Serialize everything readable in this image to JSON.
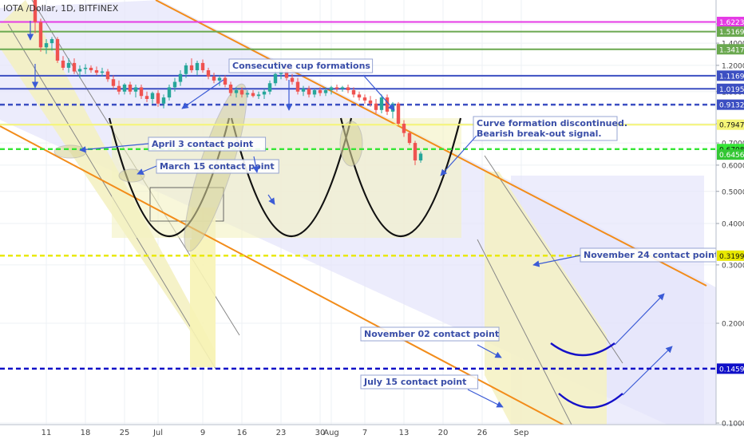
{
  "header": {
    "symbol_line": "IOTA /Dollar, 1D, BITFINEX"
  },
  "chart_data": {
    "type": "candlestick",
    "price_range": [
      0.1,
      1.65
    ],
    "price_scale": "log",
    "y_ticks": [
      {
        "value": 1.6,
        "label": "1.6000"
      },
      {
        "value": 1.4,
        "label": "1.4000"
      },
      {
        "value": 1.2,
        "label": "1.2000"
      },
      {
        "value": 1.0,
        "label": "1.0000"
      },
      {
        "value": 0.8,
        "label": "0.8000"
      },
      {
        "value": 0.7,
        "label": "0.7000"
      },
      {
        "value": 0.6,
        "label": "0.6000"
      },
      {
        "value": 0.5,
        "label": "0.5000"
      },
      {
        "value": 0.4,
        "label": "0.4000"
      },
      {
        "value": 0.3,
        "label": "0.3000"
      },
      {
        "value": 0.2,
        "label": "0.2000"
      },
      {
        "value": 0.1,
        "label": "0.1000"
      }
    ],
    "x_ticks": [
      {
        "day": 0,
        "label": "11"
      },
      {
        "day": 7,
        "label": "18"
      },
      {
        "day": 14,
        "label": "25"
      },
      {
        "day": 20,
        "label": "Jul"
      },
      {
        "day": 28,
        "label": "9"
      },
      {
        "day": 35,
        "label": "16"
      },
      {
        "day": 42,
        "label": "23"
      },
      {
        "day": 49,
        "label": "30"
      },
      {
        "day": 51,
        "label": "Aug"
      },
      {
        "day": 57,
        "label": "7"
      },
      {
        "day": 64,
        "label": "13"
      },
      {
        "day": 71,
        "label": "20"
      },
      {
        "day": 78,
        "label": "26"
      },
      {
        "day": 85,
        "label": "Sep"
      }
    ],
    "candles": [
      {
        "o": 1.9,
        "h": 2.1,
        "l": 1.5,
        "c": 1.62
      },
      {
        "o": 1.62,
        "h": 1.66,
        "l": 1.32,
        "c": 1.36
      },
      {
        "o": 1.36,
        "h": 1.44,
        "l": 1.3,
        "c": 1.4
      },
      {
        "o": 1.4,
        "h": 1.46,
        "l": 1.33,
        "c": 1.44
      },
      {
        "o": 1.44,
        "h": 1.46,
        "l": 1.22,
        "c": 1.24
      },
      {
        "o": 1.24,
        "h": 1.28,
        "l": 1.16,
        "c": 1.18
      },
      {
        "o": 1.18,
        "h": 1.26,
        "l": 1.14,
        "c": 1.22
      },
      {
        "o": 1.22,
        "h": 1.26,
        "l": 1.13,
        "c": 1.15
      },
      {
        "o": 1.15,
        "h": 1.2,
        "l": 1.1,
        "c": 1.17
      },
      {
        "o": 1.17,
        "h": 1.21,
        "l": 1.13,
        "c": 1.18
      },
      {
        "o": 1.18,
        "h": 1.2,
        "l": 1.14,
        "c": 1.16
      },
      {
        "o": 1.16,
        "h": 1.19,
        "l": 1.12,
        "c": 1.14
      },
      {
        "o": 1.14,
        "h": 1.18,
        "l": 1.11,
        "c": 1.15
      },
      {
        "o": 1.15,
        "h": 1.17,
        "l": 1.07,
        "c": 1.09
      },
      {
        "o": 1.09,
        "h": 1.12,
        "l": 1.02,
        "c": 1.04
      },
      {
        "o": 1.04,
        "h": 1.08,
        "l": 0.98,
        "c": 1.0
      },
      {
        "o": 1.0,
        "h": 1.06,
        "l": 0.98,
        "c": 1.05
      },
      {
        "o": 1.05,
        "h": 1.07,
        "l": 0.98,
        "c": 1.0
      },
      {
        "o": 1.0,
        "h": 1.05,
        "l": 0.96,
        "c": 1.03
      },
      {
        "o": 1.03,
        "h": 1.05,
        "l": 0.95,
        "c": 0.97
      },
      {
        "o": 0.97,
        "h": 1.0,
        "l": 0.93,
        "c": 0.95
      },
      {
        "o": 0.95,
        "h": 1.0,
        "l": 0.92,
        "c": 0.99
      },
      {
        "o": 0.99,
        "h": 1.01,
        "l": 0.9,
        "c": 0.92
      },
      {
        "o": 0.92,
        "h": 0.98,
        "l": 0.89,
        "c": 0.96
      },
      {
        "o": 0.96,
        "h": 1.05,
        "l": 0.94,
        "c": 1.03
      },
      {
        "o": 1.03,
        "h": 1.1,
        "l": 1.0,
        "c": 1.07
      },
      {
        "o": 1.07,
        "h": 1.16,
        "l": 1.04,
        "c": 1.13
      },
      {
        "o": 1.13,
        "h": 1.22,
        "l": 1.1,
        "c": 1.2
      },
      {
        "o": 1.2,
        "h": 1.26,
        "l": 1.14,
        "c": 1.16
      },
      {
        "o": 1.16,
        "h": 1.24,
        "l": 1.12,
        "c": 1.22
      },
      {
        "o": 1.22,
        "h": 1.25,
        "l": 1.14,
        "c": 1.16
      },
      {
        "o": 1.16,
        "h": 1.18,
        "l": 1.09,
        "c": 1.11
      },
      {
        "o": 1.11,
        "h": 1.14,
        "l": 1.06,
        "c": 1.08
      },
      {
        "o": 1.08,
        "h": 1.12,
        "l": 1.04,
        "c": 1.1
      },
      {
        "o": 1.1,
        "h": 1.12,
        "l": 1.03,
        "c": 1.05
      },
      {
        "o": 1.05,
        "h": 1.07,
        "l": 0.97,
        "c": 0.99
      },
      {
        "o": 0.99,
        "h": 1.03,
        "l": 0.96,
        "c": 1.01
      },
      {
        "o": 1.01,
        "h": 1.03,
        "l": 0.96,
        "c": 0.98
      },
      {
        "o": 0.98,
        "h": 1.01,
        "l": 0.96,
        "c": 0.99
      },
      {
        "o": 0.99,
        "h": 1.01,
        "l": 0.96,
        "c": 0.97
      },
      {
        "o": 0.97,
        "h": 1.0,
        "l": 0.95,
        "c": 0.98
      },
      {
        "o": 0.98,
        "h": 1.02,
        "l": 0.95,
        "c": 1.0
      },
      {
        "o": 1.0,
        "h": 1.08,
        "l": 0.98,
        "c": 1.06
      },
      {
        "o": 1.06,
        "h": 1.16,
        "l": 1.04,
        "c": 1.13
      },
      {
        "o": 1.13,
        "h": 1.22,
        "l": 1.09,
        "c": 1.18
      },
      {
        "o": 1.18,
        "h": 1.2,
        "l": 1.08,
        "c": 1.1
      },
      {
        "o": 1.1,
        "h": 1.13,
        "l": 1.05,
        "c": 1.07
      },
      {
        "o": 1.07,
        "h": 1.1,
        "l": 0.98,
        "c": 1.0
      },
      {
        "o": 1.0,
        "h": 1.04,
        "l": 0.97,
        "c": 1.02
      },
      {
        "o": 1.02,
        "h": 1.04,
        "l": 0.96,
        "c": 0.98
      },
      {
        "o": 0.98,
        "h": 1.02,
        "l": 0.96,
        "c": 1.01
      },
      {
        "o": 1.01,
        "h": 1.03,
        "l": 0.97,
        "c": 0.99
      },
      {
        "o": 0.99,
        "h": 1.03,
        "l": 0.97,
        "c": 1.01
      },
      {
        "o": 1.01,
        "h": 1.04,
        "l": 0.98,
        "c": 1.03
      },
      {
        "o": 1.03,
        "h": 1.05,
        "l": 1.0,
        "c": 1.02
      },
      {
        "o": 1.02,
        "h": 1.04,
        "l": 1.0,
        "c": 1.03
      },
      {
        "o": 1.03,
        "h": 1.05,
        "l": 0.99,
        "c": 1.01
      },
      {
        "o": 1.01,
        "h": 1.03,
        "l": 0.96,
        "c": 0.98
      },
      {
        "o": 0.98,
        "h": 1.0,
        "l": 0.94,
        "c": 0.96
      },
      {
        "o": 0.96,
        "h": 0.98,
        "l": 0.92,
        "c": 0.94
      },
      {
        "o": 0.94,
        "h": 0.97,
        "l": 0.9,
        "c": 0.92
      },
      {
        "o": 0.92,
        "h": 0.95,
        "l": 0.86,
        "c": 0.88
      },
      {
        "o": 0.88,
        "h": 0.98,
        "l": 0.86,
        "c": 0.96
      },
      {
        "o": 0.96,
        "h": 0.98,
        "l": 0.85,
        "c": 0.87
      },
      {
        "o": 0.87,
        "h": 0.93,
        "l": 0.83,
        "c": 0.92
      },
      {
        "o": 0.92,
        "h": 0.93,
        "l": 0.79,
        "c": 0.8
      },
      {
        "o": 0.8,
        "h": 0.82,
        "l": 0.73,
        "c": 0.75
      },
      {
        "o": 0.75,
        "h": 0.76,
        "l": 0.69,
        "c": 0.7
      },
      {
        "o": 0.7,
        "h": 0.71,
        "l": 0.6,
        "c": 0.62
      },
      {
        "o": 0.62,
        "h": 0.66,
        "l": 0.61,
        "c": 0.65
      }
    ],
    "horizontal_levels": [
      {
        "value": 1.6223,
        "label": "1.6223",
        "color": "#e53be5",
        "style": "solid"
      },
      {
        "value": 1.5169,
        "label": "1.5169",
        "color": "#6aa84f",
        "style": "solid"
      },
      {
        "value": 1.3417,
        "label": "1.3417",
        "color": "#6aa84f",
        "style": "solid"
      },
      {
        "value": 1.1169,
        "label": "1.1169",
        "color": "#3c4fc2",
        "style": "solid"
      },
      {
        "value": 1.0195,
        "label": "1.0195",
        "color": "#3c4fc2",
        "style": "solid"
      },
      {
        "value": 0.9132,
        "label": "0.9132",
        "color": "#3c4fc2",
        "style": "dashed"
      },
      {
        "value": 0.7947,
        "label": "0.7947",
        "color": "#f5f577",
        "style": "solid"
      },
      {
        "value": 0.6708,
        "label": "0.6708",
        "color": "#35e635",
        "style": "dashed"
      },
      {
        "value": 0.3199,
        "label": "0.3199",
        "color": "#e8e800",
        "style": "dashed"
      },
      {
        "value": 0.1459,
        "label": "0.1459",
        "color": "#1010c8",
        "style": "dashed"
      }
    ],
    "price_badges": [
      {
        "value": 0.6456,
        "label": "0.6456",
        "color": "#34c734"
      }
    ],
    "annotations": [
      "Consecutive cup formations",
      "Curve formation discontinued.",
      "Bearish break-out signal.",
      "April 3 contact point",
      "March 15 contact point",
      "November 24 contact point",
      "November 02 contact point",
      "July 15 contact point"
    ],
    "colors": {
      "up_candle": "#26a69a",
      "down_candle": "#ef5350",
      "channel_line": "#f28c1a",
      "channel_fill": "#e6e6fb",
      "highlight_fill": "#f4f1c2"
    }
  }
}
